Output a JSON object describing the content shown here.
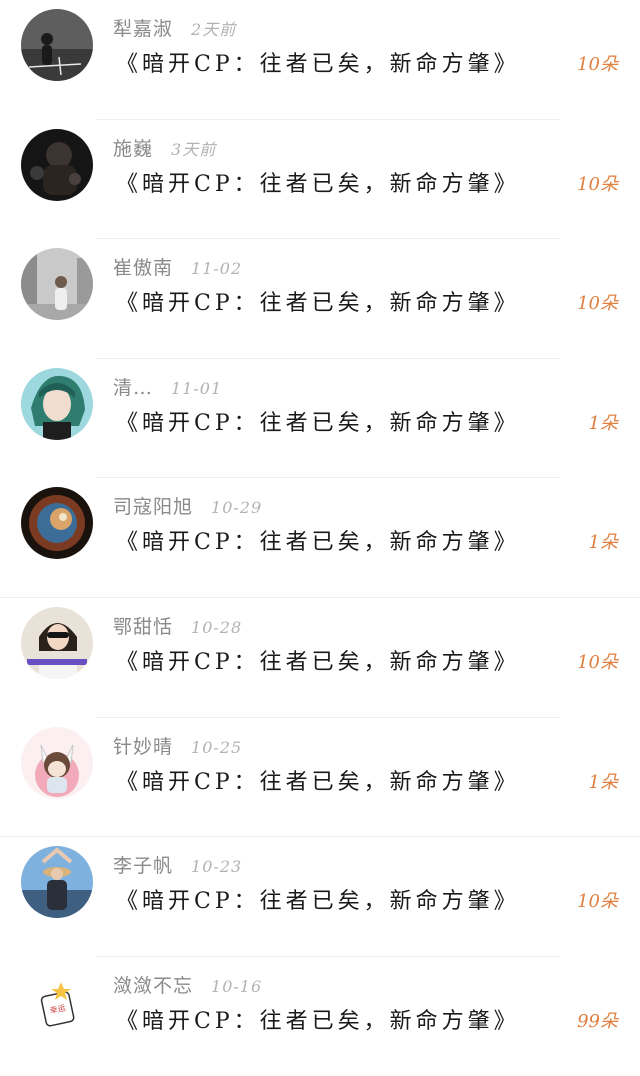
{
  "rows": [
    {
      "name": "犁嘉淑",
      "time": "2天前",
      "gift": "《暗开CP：往者已矣，新命方肇》",
      "count": "10朵",
      "avatar": "dark-silhouette"
    },
    {
      "name": "施巍",
      "time": "3天前",
      "gift": "《暗开CP：往者已矣，新命方肇》",
      "count": "10朵",
      "avatar": "dark-figure"
    },
    {
      "name": "崔傲南",
      "time": "11-02",
      "gift": "《暗开CP：往者已矣，新命方肇》",
      "count": "10朵",
      "avatar": "street-girl"
    },
    {
      "name": "清…",
      "time": "11-01",
      "gift": "《暗开CP：往者已矣，新命方肇》",
      "count": "1朵",
      "avatar": "anime-green-hair"
    },
    {
      "name": "司寇阳旭",
      "time": "10-29",
      "gift": "《暗开CP：往者已矣，新命方肇》",
      "count": "1朵",
      "avatar": "galaxy"
    },
    {
      "name": "鄂甜恬",
      "time": "10-28",
      "gift": "《暗开CP：往者已矣，新命方肇》",
      "count": "10朵",
      "avatar": "sunglasses-woman"
    },
    {
      "name": "针妙晴",
      "time": "10-25",
      "gift": "《暗开CP：往者已矣，新命方肇》",
      "count": "1朵",
      "avatar": "cartoon-kid"
    },
    {
      "name": "李子帆",
      "time": "10-23",
      "gift": "《暗开CP：往者已矣，新命方肇》",
      "count": "10朵",
      "avatar": "beach-hat"
    },
    {
      "name": "潋潋不忘",
      "time": "10-16",
      "gift": "《暗开CP：往者已矣，新命方肇》",
      "count": "99朵",
      "avatar": "lucky-sticker"
    }
  ],
  "avatar_sticker_text": "幸运",
  "colors": {
    "count": "#e07f3f",
    "name": "#8a8a8a",
    "time": "#b2b2b2",
    "gift": "#1a1a1a"
  }
}
